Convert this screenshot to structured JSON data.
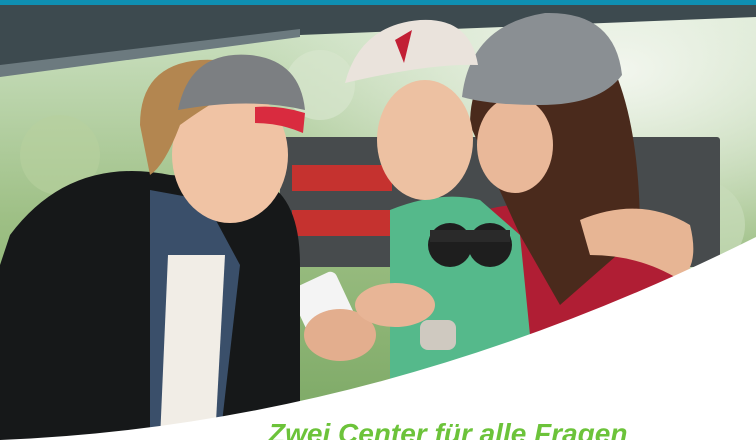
{
  "banner": {
    "headline": "Zwei Center für alle Fragen",
    "photo_alt": "Drei junge Leute schauen lachend auf ein Smartphone",
    "colors": {
      "top_bar": "#0f8fb2",
      "headline": "#6cc33a",
      "background": "#ffffff"
    }
  }
}
